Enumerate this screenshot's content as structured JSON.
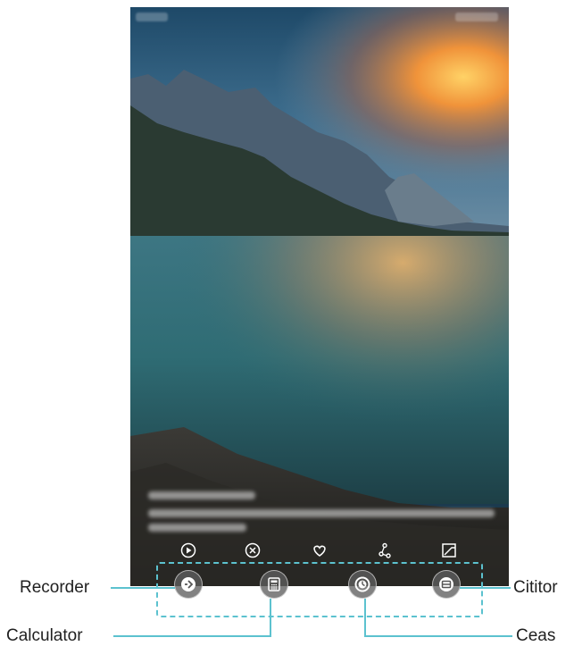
{
  "phone": {
    "wallpaper": "mountain-lake-sunset",
    "accent_color": "#5cc2cf"
  },
  "lock_actions": [
    {
      "name": "play-icon",
      "label": "play"
    },
    {
      "name": "close-circle-icon",
      "label": "remove"
    },
    {
      "name": "heart-icon",
      "label": "favorite"
    },
    {
      "name": "share-icon",
      "label": "share"
    },
    {
      "name": "image-icon",
      "label": "gallery"
    }
  ],
  "shortcuts": {
    "recorder": {
      "label": "Recorder",
      "icon": "microphone-icon"
    },
    "calculator": {
      "label": "Calculator",
      "icon": "calculator-icon"
    },
    "clock": {
      "label": "Ceas",
      "icon": "clock-icon"
    },
    "reader": {
      "label": "Cititor",
      "icon": "scanner-icon"
    }
  }
}
